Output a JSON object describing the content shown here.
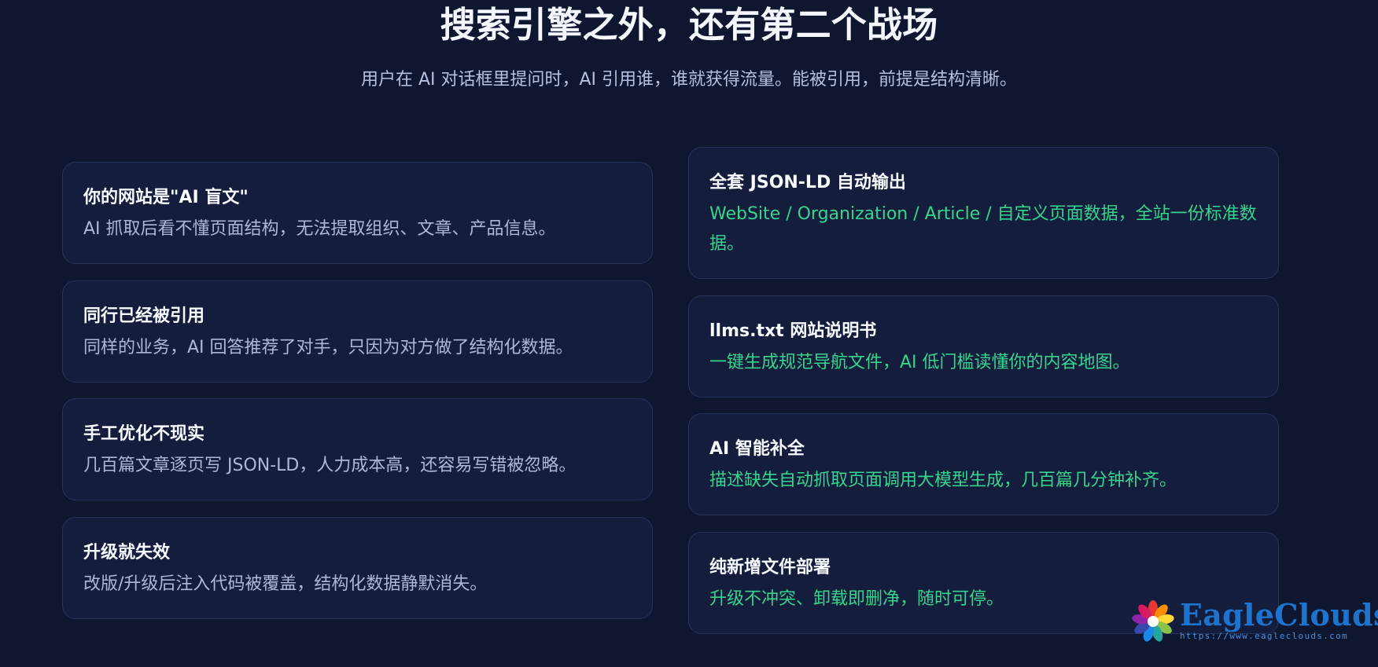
{
  "header": {
    "title": "搜索引擎之外，还有第二个战场",
    "subtitle": "用户在 AI 对话框里提问时，AI 引用谁，谁就获得流量。能被引用，前提是结构清晰。"
  },
  "problems": [
    {
      "title": "你的网站是\"AI 盲文\"",
      "description": "AI 抓取后看不懂页面结构，无法提取组织、文章、产品信息。"
    },
    {
      "title": "同行已经被引用",
      "description": "同样的业务，AI 回答推荐了对手，只因为对方做了结构化数据。"
    },
    {
      "title": "手工优化不现实",
      "description": "几百篇文章逐页写 JSON-LD，人力成本高，还容易写错被忽略。"
    },
    {
      "title": "升级就失效",
      "description": "改版/升级后注入代码被覆盖，结构化数据静默消失。"
    }
  ],
  "solutions": [
    {
      "title": "全套 JSON-LD 自动输出",
      "description": "WebSite / Organization / Article / 自定义页面数据，全站一份标准数据。"
    },
    {
      "title": "llms.txt 网站说明书",
      "description": "一键生成规范导航文件，AI 低门槛读懂你的内容地图。"
    },
    {
      "title": "AI 智能补全",
      "description": "描述缺失自动抓取页面调用大模型生成，几百篇几分钟补齐。"
    },
    {
      "title": "纯新增文件部署",
      "description": "升级不冲突、卸载即删净，随时可停。"
    }
  ],
  "branding": {
    "name": "EagleClouds",
    "url": "https://www.eagleclouds.com"
  },
  "colors": {
    "background": "#0f1730",
    "card": "#141d3c",
    "card_border": "#27345a",
    "title_text": "#f8fbff",
    "body_text": "#aeb8d5",
    "accent_green": "#36d58e",
    "brand_blue": "#1e73cc"
  },
  "icons": {
    "logo": "eagleclouds-flower-logo-icon"
  }
}
